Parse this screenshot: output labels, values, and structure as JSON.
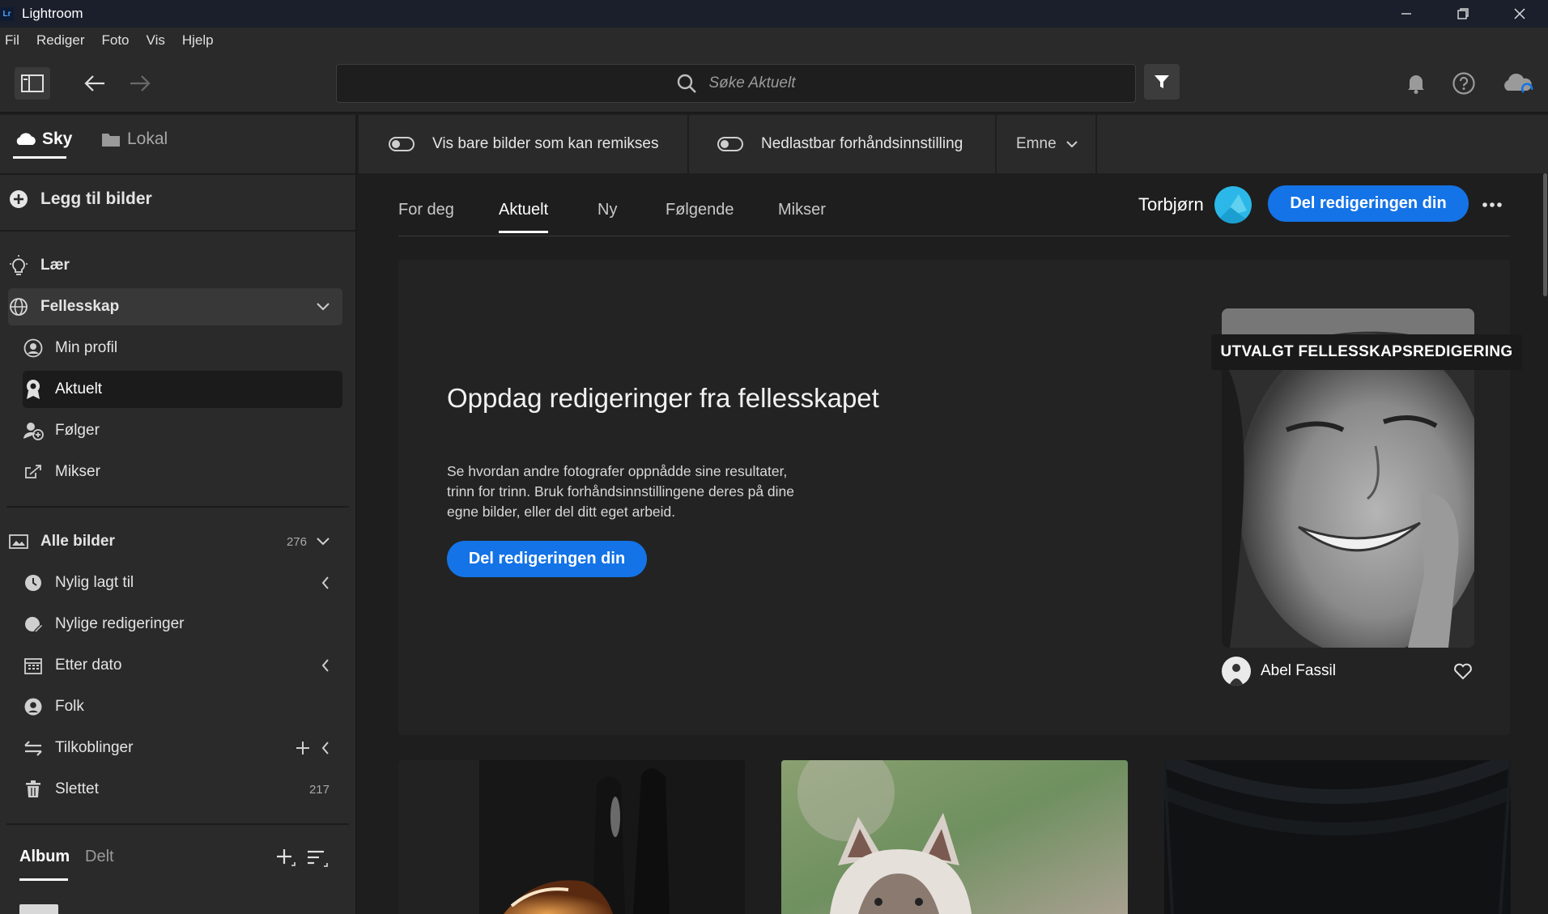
{
  "window": {
    "app_title": "Lightroom",
    "logo_text": "Lr"
  },
  "menu": [
    "Fil",
    "Rediger",
    "Foto",
    "Vis",
    "Hjelp"
  ],
  "toolbar": {
    "search_placeholder": "Søke Aktuelt"
  },
  "sidebar": {
    "source_tabs": [
      {
        "label": "Sky",
        "active": true
      },
      {
        "label": "Lokal",
        "active": false
      }
    ],
    "add_photos_label": "Legg til bilder",
    "learn_label": "Lær",
    "community": {
      "label": "Fellesskap",
      "items": [
        {
          "label": "Min profil"
        },
        {
          "label": "Aktuelt",
          "selected": true
        },
        {
          "label": "Følger"
        },
        {
          "label": "Mikser"
        }
      ]
    },
    "all_photos": {
      "label": "Alle bilder",
      "count": "276"
    },
    "library_items": [
      {
        "label": "Nylig lagt til"
      },
      {
        "label": "Nylige redigeringer"
      },
      {
        "label": "Etter dato"
      },
      {
        "label": "Folk"
      },
      {
        "label": "Tilkoblinger"
      },
      {
        "label": "Slettet",
        "count": "217"
      }
    ],
    "album_tabs": [
      {
        "label": "Album",
        "active": true
      },
      {
        "label": "Delt",
        "active": false
      }
    ]
  },
  "filterbar": {
    "remix_toggle_label": "Vis bare bilder som kan remikses",
    "preset_toggle_label": "Nedlastbar forhåndsinnstilling",
    "topic_label": "Emne"
  },
  "content_tabs": [
    {
      "label": "For deg"
    },
    {
      "label": "Aktuelt",
      "active": true
    },
    {
      "label": "Ny"
    },
    {
      "label": "Følgende"
    },
    {
      "label": "Mikser"
    }
  ],
  "user": {
    "name": "Torbjørn"
  },
  "share_button_label": "Del redigeringen din",
  "hero": {
    "title": "Oppdag redigeringer fra fellesskapet",
    "description": "Se hvordan andre fotografer oppnådde sine resultater, trinn for trinn. Bruk forhåndsinnstillingene deres på dine egne bilder, eller del ditt eget arbeid.",
    "description_lines": [
      "Se hvordan andre fotografer oppnådde sine resultater,",
      "trinn for trinn. Bruk forhåndsinnstillingene deres på dine",
      "egne bilder, eller del ditt eget arbeid."
    ],
    "button_label": "Del redigeringen din",
    "featured_badge": "UTVALGT FELLESSKAPSREDIGERING",
    "featured_author": "Abel Fassil"
  },
  "colors": {
    "accent": "#1473e6",
    "avatar": "#2bb8e8",
    "panel": "#2a2a2a",
    "background": "#1e1e1e"
  }
}
